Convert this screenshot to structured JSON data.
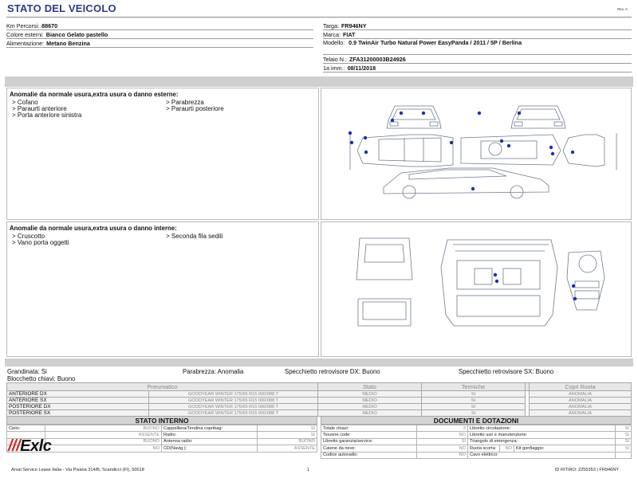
{
  "header": {
    "title": "STATO DEL VEICOLO",
    "revision": "Rev. A"
  },
  "vehicle_left": [
    {
      "label": "Km Percorsi:",
      "value": "88670"
    },
    {
      "label": "Colore esterni:",
      "value": "Bianco Gelato pastello"
    },
    {
      "label": "Alimentazione:",
      "value": "Metano Benzina"
    }
  ],
  "vehicle_right": {
    "targa": {
      "label": "Targa:",
      "value": "FR946NY"
    },
    "marca": {
      "label": "Marca:",
      "value": "FIAT"
    },
    "modello": {
      "label": "Modello:",
      "value": "0.9 TwinAir Turbo Natural Power EasyPanda / 2011 / 5P / Berlina"
    },
    "telaio": {
      "label": "Telaio N.:",
      "value": "ZFA31200003B24926"
    },
    "immatricolazione": {
      "label": "1a imm.:",
      "value": "08/11/2018"
    }
  },
  "external_damage": {
    "title": "Anomalie da normale usura,extra usura o danno esterne:",
    "items": [
      "> Cofano",
      "> Parabrezza",
      "> Paraurti anteriore",
      "> Paraurti posteriore",
      "> Porta anteriore sinistra"
    ]
  },
  "internal_damage": {
    "title": "Anomalie da normale usura,extra usura o danno interne:",
    "items": [
      "> Cruscotto",
      "> Seconda fila sedili",
      "> Vano porta oggetti"
    ]
  },
  "summary": {
    "grandinata": "Grandinata: Si",
    "parabrezza": "Parabrezza: Anomalia",
    "specchietto_dx": "Specchietto retrovisore DX: Buono",
    "specchietto_sx": "Specchietto retrovisore SX: Buono",
    "blocchetto": "Blocchetto chiavi: Buono"
  },
  "tyres": {
    "headers": {
      "pneumatico": "Pneumatico",
      "stato": "Stato",
      "termiche": "Termiche",
      "copri_ruota": "Copri Ruota"
    },
    "rows": [
      {
        "pos": "ANTERIORE DX",
        "tyre": "GOODYEAR WINTER 175/65 R15 000/088 T",
        "stato": "MEDIO",
        "termiche": "SI",
        "copri": "ANOMALIA"
      },
      {
        "pos": "ANTERIORE SX",
        "tyre": "GOODYEAR WINTER 175/65 R15 000/088 T",
        "stato": "MEDIO",
        "termiche": "SI",
        "copri": "ANOMALIA"
      },
      {
        "pos": "POSTERIORE DX",
        "tyre": "GOODYEAR WINTER 175/65 R15 000/088 T",
        "stato": "MEDIO",
        "termiche": "SI",
        "copri": "ANOMALIA"
      },
      {
        "pos": "POSTERIORE SX",
        "tyre": "GOODYEAR WINTER 175/65 R15 000/088 T",
        "stato": "MEDIO",
        "termiche": "SI",
        "copri": "ANOMALIA"
      }
    ]
  },
  "stato_interno": {
    "title": "STATO INTERNO",
    "rows": [
      {
        "k1": "Cielo:",
        "v1": "BUONO",
        "k2": "Cappelliera/Tendina copribag:",
        "v2": "SI"
      },
      {
        "k1": "",
        "v1": "ASSENTE",
        "k2": "Radio:",
        "v2": "SI"
      },
      {
        "k1": "",
        "v1": "BUONO",
        "k2": "Antenna radio:",
        "v2": "BUONO"
      },
      {
        "k1": "",
        "v1": "NO",
        "k2": "CD(Navig.):",
        "v2": "ASSENTE"
      }
    ]
  },
  "documenti": {
    "title": "DOCUMENTI E DOTAZIONI",
    "rows": [
      {
        "k1": "Totale chiavi:",
        "v1": "2",
        "k2": "Libretto circolazione:",
        "v2": "SI"
      },
      {
        "k1": "Tessere code:",
        "v1": "NO",
        "k2": "Libretto uso e manutenzione:",
        "v2": "SI"
      },
      {
        "k1": "Libretto garanzia/service:",
        "v1": "SI",
        "k2": "Triangolo di emergenza:",
        "v2": "SI"
      },
      {
        "k1": "Catene da neve:",
        "v1": "NO",
        "k2": "Ruota scorta:",
        "v2": "NO",
        "k3": "Kit gonfiaggio:",
        "v3": "SI"
      },
      {
        "k1": "Codice autoradio:",
        "v1": "NO",
        "k2": "Cavo elettrico:",
        "v2": ""
      }
    ]
  },
  "logo": {
    "text": "Exlc",
    "slashes": "///"
  },
  "footer": {
    "address": "Arval Service Lease Italia - Via Pisana 314/B, Scandicci (FI), 50018",
    "page": "1",
    "ritiro": "ID RITIRO: 2255353 | FR946NY"
  },
  "colors": {
    "title": "#2b3a8a",
    "marker": "#1d2fb5",
    "accent_red": "#d32b2b",
    "bar": "#cfcfcf"
  }
}
